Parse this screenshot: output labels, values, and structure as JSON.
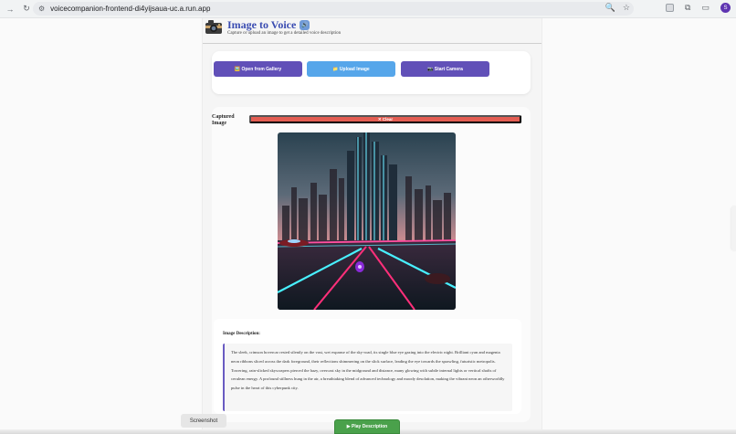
{
  "browser": {
    "url": "voicecompanion-frontend-di4yijsaua-uc.a.run.app",
    "profile_initial": "S"
  },
  "header": {
    "title": "Image to Voice",
    "title_badge": "🔊",
    "subtitle": "Capture or upload an image to get a detailed voice description"
  },
  "actions": {
    "gallery_label": "🖼️ Open from Gallery",
    "upload_label": "📁 Upload Image",
    "camera_label": "📷 Start Camera"
  },
  "captured": {
    "label": "Captured Image",
    "clear_label": "✕ Clear"
  },
  "description": {
    "heading": "Image Description:",
    "text": "The sleek, crimson hovercar rested silently on the vast, wet expanse of the sky-road, its single blue eye gazing into the electric night. Brilliant cyan and magenta neon ribbons sliced across the dark foreground, their reflections shimmering on the slick surface, leading the eye towards the sprawling, futuristic metropolis. Towering, rain-slicked skyscrapers pierced the hazy, overcast sky in the midground and distance, many glowing with subtle internal lights or vertical shafts of cerulean energy. A profound stillness hung in the air, a breathtaking blend of advanced technology and moody desolation, making the vibrant neon an otherworldly pulse in the heart of this cyberpunk city."
  },
  "footer": {
    "play_label": "▶ Play Description",
    "screenshot_label": "Screenshot"
  },
  "colors": {
    "accent_purple": "#6150b8",
    "accent_blue": "#56a6ea",
    "clear_red": "#e35d52",
    "play_green": "#4aa14b"
  }
}
